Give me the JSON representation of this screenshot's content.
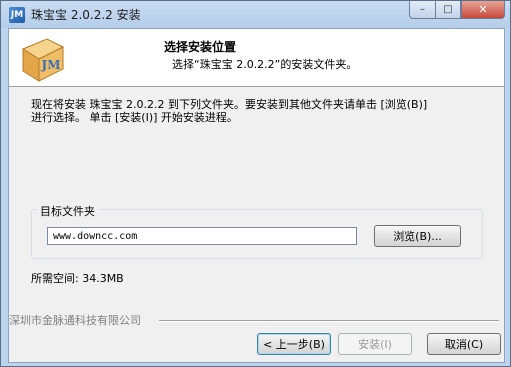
{
  "window": {
    "title": "珠宝宝 2.0.2.2 安装",
    "icon": "app-logo-icon",
    "icon_text": "JM"
  },
  "controls": {
    "minimize_glyph": "–",
    "maximize_glyph": "□",
    "close_glyph": "✕"
  },
  "header": {
    "title": "选择安装位置",
    "subtitle": "选择“珠宝宝 2.0.2.2”的安装文件夹。",
    "logo_text": "JM"
  },
  "description": "现在将安装 珠宝宝 2.0.2.2 到下列文件夹。要安装到其他文件夹请单击 [浏览(B)]\n进行选择。 单击 [安装(I)] 开始安装进程。",
  "destination": {
    "group_label": "目标文件夹",
    "path_value": "www.downcc.com",
    "browse_label": "浏览(B)..."
  },
  "space_required": "所需空间: 34.3MB",
  "branding": "深圳市金脉通科技有限公司",
  "footer": {
    "back_label": "< 上一步(B)",
    "install_label": "安装(I)",
    "cancel_label": "取消(C)"
  },
  "colors": {
    "title_bar": "#bcd4ee",
    "dialog_bg": "#f0f0f0",
    "logo_box": "#e9b25a"
  }
}
